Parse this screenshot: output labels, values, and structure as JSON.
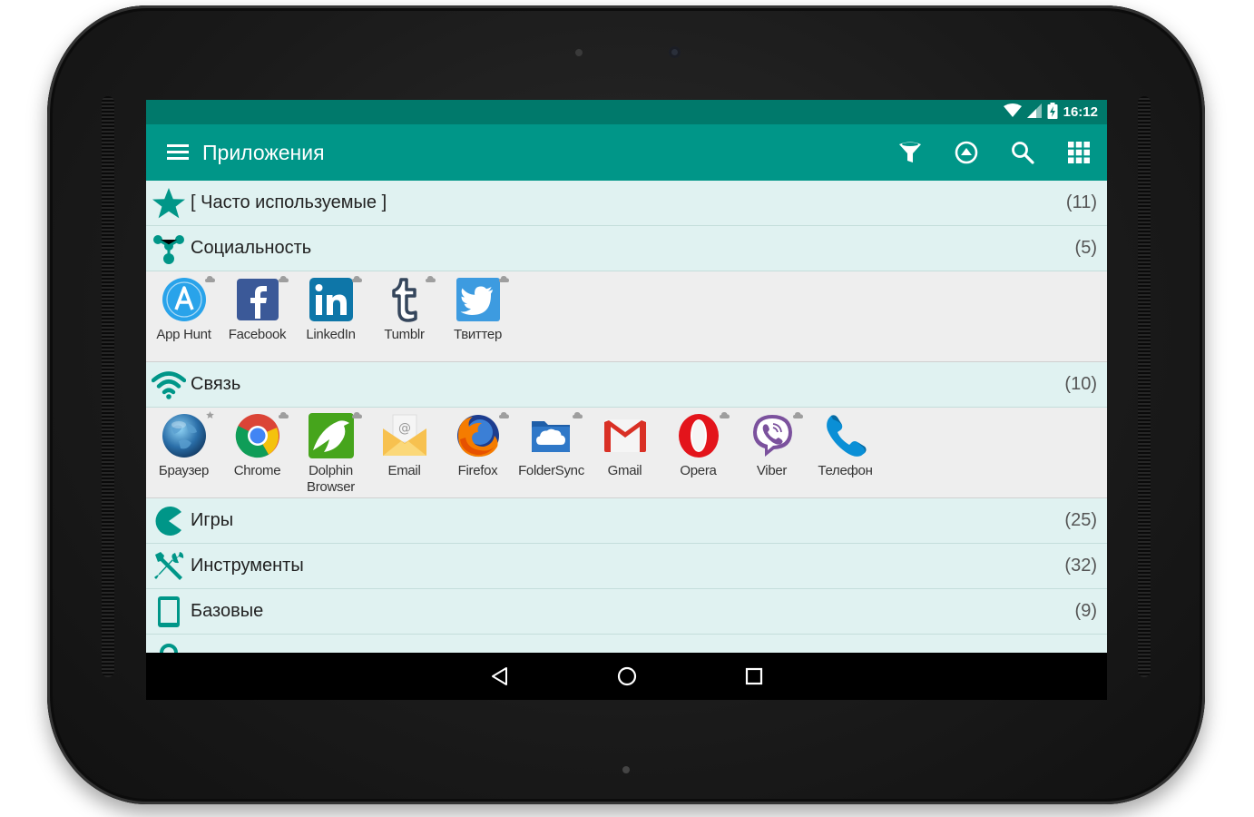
{
  "statusbar": {
    "time": "16:12"
  },
  "appbar": {
    "title": "Приложения",
    "actions": [
      "filter-icon",
      "upload-circle-icon",
      "search-icon",
      "grid-icon"
    ]
  },
  "colors": {
    "primary": "#009688",
    "primary_dark": "#00796b",
    "row_bg": "#e0f2f1",
    "grid_bg": "#eeeeee"
  },
  "categories": [
    {
      "name": "[ Часто используемые ]",
      "count": "(11)",
      "icon": "star-icon"
    },
    {
      "name": "Социальность",
      "count": "(5)",
      "icon": "social-icon",
      "apps": [
        {
          "label": "App Hunt",
          "icon": "apphunt-icon",
          "badge": "cloud"
        },
        {
          "label": "Facebook",
          "icon": "facebook-icon",
          "badge": "cloud"
        },
        {
          "label": "LinkedIn",
          "icon": "linkedin-icon",
          "badge": "cloud"
        },
        {
          "label": "Tumblr",
          "icon": "tumblr-icon",
          "badge": "cloud"
        },
        {
          "label": "Твиттер",
          "icon": "twitter-icon",
          "badge": "cloud"
        }
      ]
    },
    {
      "name": "Связь",
      "count": "(10)",
      "icon": "wifi-icon",
      "apps": [
        {
          "label": "Браузер",
          "icon": "browser-globe-icon",
          "badge": "star"
        },
        {
          "label": "Chrome",
          "icon": "chrome-icon",
          "badge": "cloud"
        },
        {
          "label": "Dolphin Browser",
          "label_line1": "Dolphin",
          "label_line2": "Browser",
          "icon": "dolphin-icon",
          "badge": "cloud"
        },
        {
          "label": "Email",
          "icon": "email-icon",
          "badge": ""
        },
        {
          "label": "Firefox",
          "icon": "firefox-icon",
          "badge": "cloud"
        },
        {
          "label": "FolderSync",
          "icon": "foldersync-icon",
          "badge": "cloud"
        },
        {
          "label": "Gmail",
          "icon": "gmail-icon",
          "badge": ""
        },
        {
          "label": "Opera",
          "icon": "opera-icon",
          "badge": "cloud"
        },
        {
          "label": "Viber",
          "icon": "viber-icon",
          "badge": "cloud"
        },
        {
          "label": "Телефон",
          "icon": "phone-icon",
          "badge": ""
        }
      ]
    },
    {
      "name": "Игры",
      "count": "(25)",
      "icon": "pacman-icon"
    },
    {
      "name": "Инструменты",
      "count": "(32)",
      "icon": "tools-icon"
    },
    {
      "name": "Базовые",
      "count": "(9)",
      "icon": "tablet-icon"
    }
  ],
  "navbar": {
    "buttons": [
      "back-icon",
      "home-icon",
      "recents-icon"
    ]
  }
}
